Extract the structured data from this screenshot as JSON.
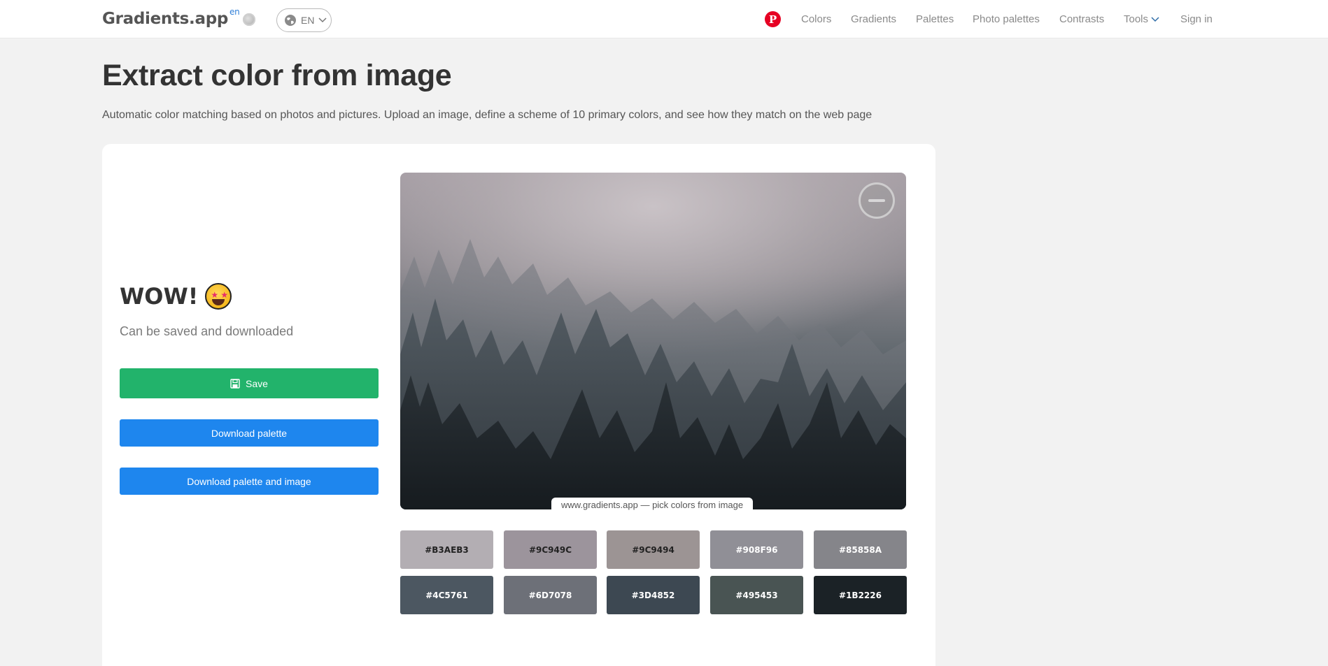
{
  "header": {
    "logo": "Gradients.app",
    "logo_sup": "en",
    "lang": "EN",
    "nav": [
      {
        "label": "Colors",
        "name": "nav-colors"
      },
      {
        "label": "Gradients",
        "name": "nav-gradients"
      },
      {
        "label": "Palettes",
        "name": "nav-palettes"
      },
      {
        "label": "Photo palettes",
        "name": "nav-photo-palettes"
      },
      {
        "label": "Contrasts",
        "name": "nav-contrasts"
      }
    ],
    "tools": "Tools",
    "sign_in": "Sign in",
    "pinterest_glyph": "P"
  },
  "page": {
    "title": "Extract color from image",
    "subtitle": "Automatic color matching based on photos and pictures. Upload an image, define a scheme of 10 primary colors, and see how they match on the web page"
  },
  "panel": {
    "wow": "WOW!",
    "can_save": "Can be saved and downloaded",
    "save": "Save",
    "download_palette": "Download palette",
    "download_palette_image": "Download palette and image",
    "watermark": "www.gradients.app — pick colors from image"
  },
  "colors": {
    "save_button": "#22b36b",
    "download_button": "#1e86ee",
    "tools_link": "#2f6da8",
    "pinterest": "#e60023"
  },
  "swatches": [
    {
      "hex": "#B3AEB3",
      "text_color": "#222"
    },
    {
      "hex": "#9C949C",
      "text_color": "#222"
    },
    {
      "hex": "#9C9494",
      "text_color": "#222"
    },
    {
      "hex": "#908F96",
      "text_color": "#fff"
    },
    {
      "hex": "#85858A",
      "text_color": "#fff"
    },
    {
      "hex": "#4C5761",
      "text_color": "#fff"
    },
    {
      "hex": "#6D7078",
      "text_color": "#fff"
    },
    {
      "hex": "#3D4852",
      "text_color": "#fff"
    },
    {
      "hex": "#495453",
      "text_color": "#fff"
    },
    {
      "hex": "#1B2226",
      "text_color": "#fff"
    }
  ]
}
